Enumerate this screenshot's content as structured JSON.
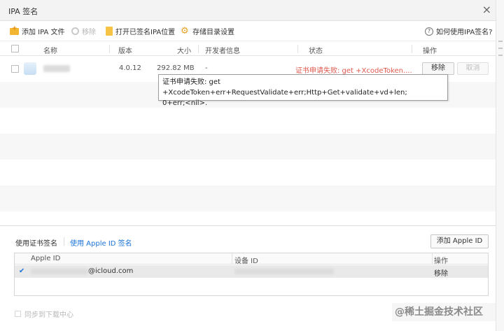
{
  "window": {
    "title": "IPA 签名",
    "close_glyph": "×"
  },
  "toolbar": {
    "add_ipa": "添加 IPA 文件",
    "remove": "移除",
    "open_folder": "打开已签名IPA位置",
    "save_settings": "存储目录设置",
    "help": "如何使用IPA签名?",
    "help_glyph": "?"
  },
  "table": {
    "headers": {
      "name": "名称",
      "version": "版本",
      "size": "大小",
      "developer": "开发者信息",
      "status": "状态",
      "action": "操作"
    },
    "rows": [
      {
        "version": "4.0.12",
        "size": "292.82 MB",
        "developer": "-",
        "status": "证书申请失败: get +XcodeToken....",
        "remove_label": "移除",
        "cancel_label": "取消"
      }
    ]
  },
  "tooltip": {
    "line1": "证书申请失败: get +XcodeToken+err+RequestValidate+err;Http+Get+validate+vd+len;",
    "line2": "0+err;<nil>."
  },
  "signing": {
    "tab_cert": "使用证书签名",
    "tab_appleid": "使用 Apple ID 签名",
    "add_appleid": "添加 Apple ID",
    "columns": {
      "apple_id": "Apple ID",
      "device_id": "设备 ID",
      "action": "操作"
    },
    "accounts": [
      {
        "checked": "✔",
        "apple_id_suffix": "@icloud.com",
        "action": "移除"
      }
    ]
  },
  "footer": {
    "sync_label": "同步到下载中心",
    "watermark": "@稀土掘金技术社区"
  },
  "colors": {
    "status_error": "#e0594f",
    "link": "#1a73d9",
    "folder_icon": "#f2b632"
  }
}
